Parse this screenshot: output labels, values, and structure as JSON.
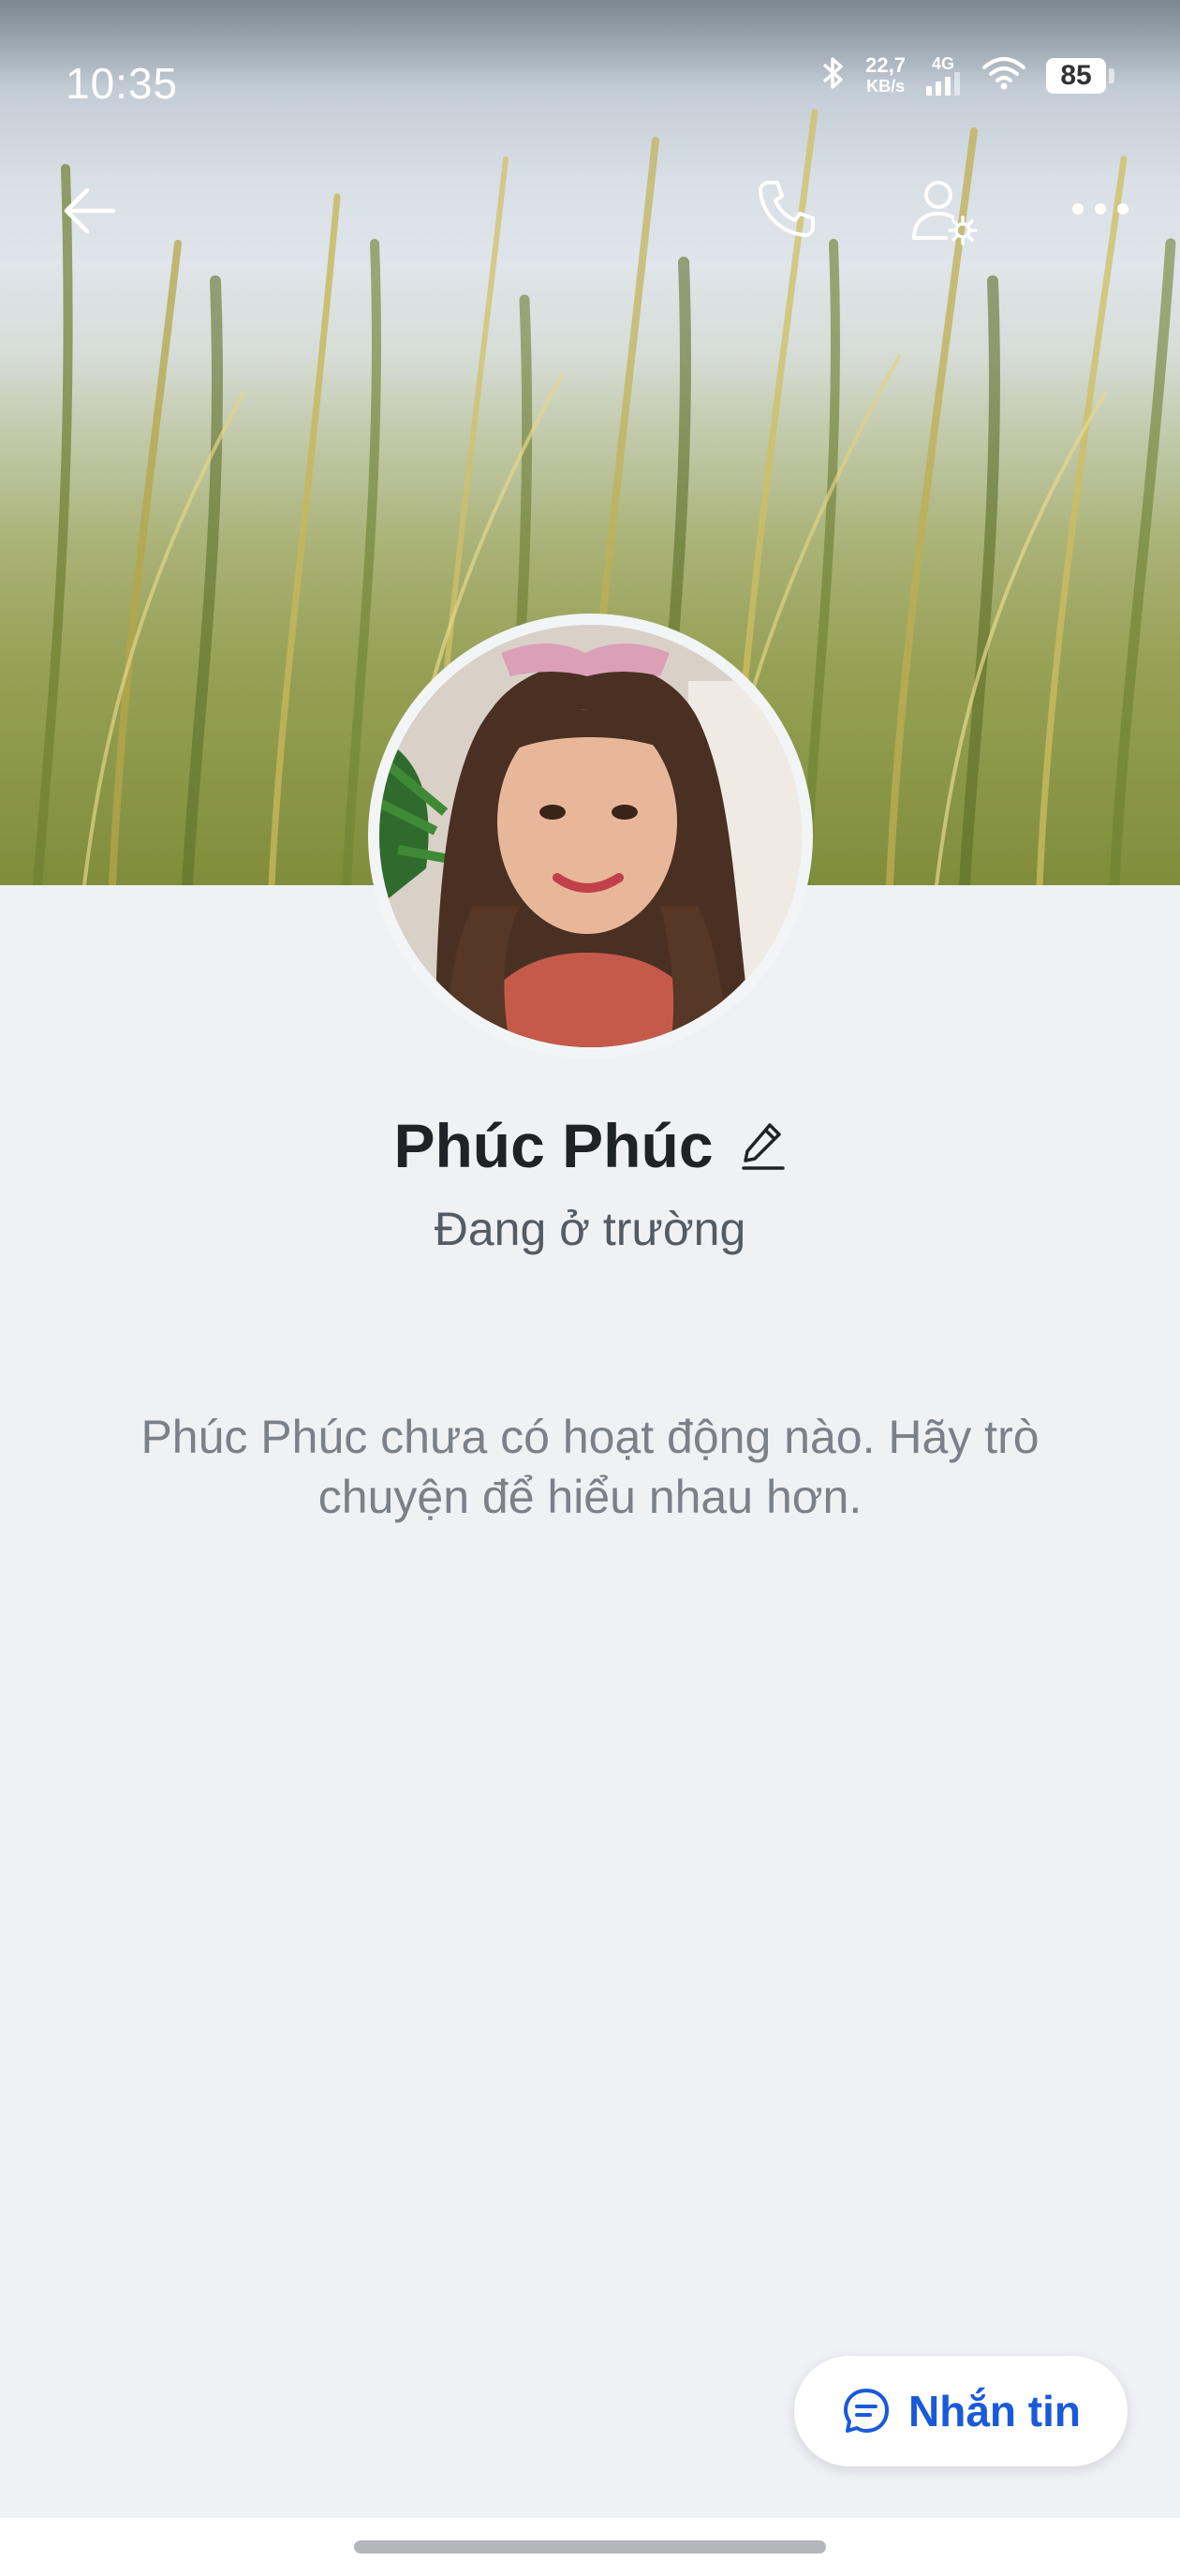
{
  "status_bar": {
    "time": "10:35",
    "net_speed_value": "22,7",
    "net_speed_unit": "KB/s",
    "network_type": "4G",
    "battery": "85"
  },
  "profile": {
    "name": "Phúc Phúc",
    "status": "Đang ở trường",
    "empty_message": "Phúc Phúc chưa có hoạt động nào. Hãy trò chuyện để hiểu nhau hơn."
  },
  "actions": {
    "message_label": "Nhắn tin"
  },
  "icons": {
    "back": "back-arrow-icon",
    "call": "phone-icon",
    "settings": "user-settings-icon",
    "more": "more-icon",
    "edit": "pencil-icon",
    "chat": "chat-bubble-icon"
  },
  "colors": {
    "accent": "#1a5ad9",
    "background": "#f0f1f5"
  }
}
